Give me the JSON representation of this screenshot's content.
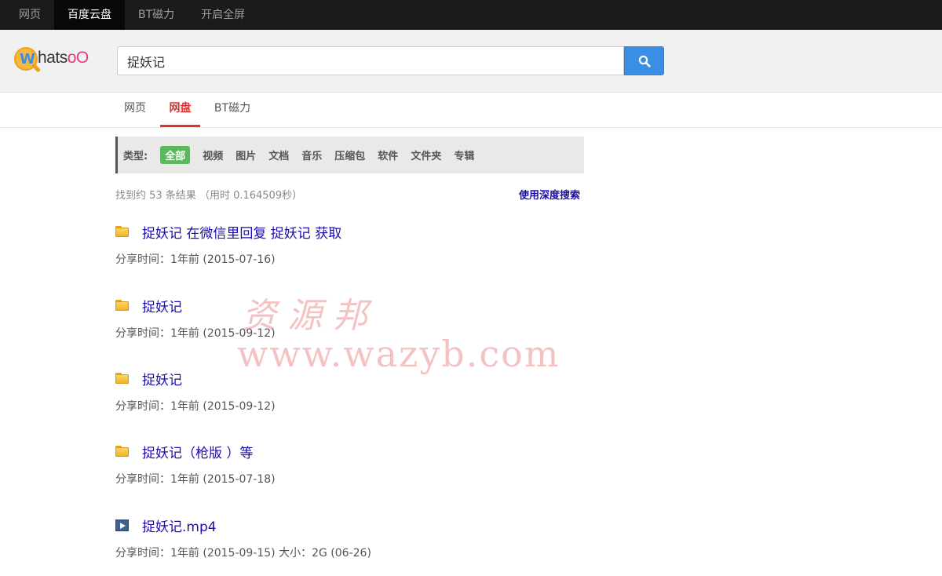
{
  "topbar": {
    "items": [
      {
        "label": "网页",
        "active": false
      },
      {
        "label": "百度云盘",
        "active": true
      },
      {
        "label": "BT磁力",
        "active": false
      },
      {
        "label": "开启全屏",
        "active": false
      }
    ]
  },
  "header": {
    "logo_w": "W",
    "logo_text_a": "hats",
    "logo_text_b": "oO",
    "search_value": "捉妖记",
    "search_icon": "search-icon"
  },
  "tabs": [
    {
      "label": "网页",
      "active": false
    },
    {
      "label": "网盘",
      "active": true
    },
    {
      "label": "BT磁力",
      "active": false
    }
  ],
  "filter": {
    "label": "类型:",
    "types": [
      "全部",
      "视频",
      "图片",
      "文档",
      "音乐",
      "压缩包",
      "软件",
      "文件夹",
      "专辑"
    ],
    "active_index": 0
  },
  "stats": {
    "text": "找到约 53 条结果 （用时 0.164509秒）",
    "deep_search": "使用深度搜索"
  },
  "results": [
    {
      "icon": "folder-icon",
      "title": "捉妖记 在微信里回复 捉妖记 获取",
      "meta": "分享时间：1年前 (2015-07-16)"
    },
    {
      "icon": "folder-icon",
      "title": "捉妖记",
      "meta": "分享时间：1年前 (2015-09-12)"
    },
    {
      "icon": "folder-icon",
      "title": "捉妖记",
      "meta": "分享时间：1年前 (2015-09-12)"
    },
    {
      "icon": "folder-icon",
      "title": "捉妖记（枪版 ）等",
      "meta": "分享时间：1年前 (2015-07-18)"
    },
    {
      "icon": "video-icon",
      "title": "捉妖记.mp4",
      "meta": "分享时间：1年前 (2015-09-15)  大小：2G (06-26)"
    }
  ],
  "watermark": {
    "line1": "资源邦",
    "line2": "www.wazyb.com"
  },
  "colors": {
    "accent_tab": "#d33333",
    "search_button": "#3a8ee6",
    "active_type": "#5cb85c",
    "link": "#1a0dab"
  }
}
